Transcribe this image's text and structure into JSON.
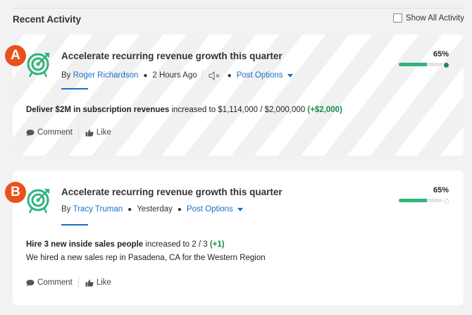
{
  "header": {
    "title": "Recent Activity",
    "show_all_label": "Show All Activity"
  },
  "colors": {
    "accent_link": "#1a6fc9",
    "badge": "#e9511c",
    "progress_fill": "#2fb47c",
    "delta_text": "#1d8a4e",
    "goal_icon": "#2fb47c"
  },
  "cards": [
    {
      "badge": "A",
      "icon": "target-arrow-icon",
      "title": "Accelerate recurring revenue growth this quarter",
      "by_label": "By",
      "author": "Roger Richardson",
      "time": "2 Hours Ago",
      "muted_icon": "speaker-muted-icon",
      "post_options_label": "Post Options",
      "progress_percent_label": "65%",
      "progress_value": 65,
      "update_metric": "Deliver $2M in subscription revenues",
      "update_text": "increased to $1,114,000 / $2,000,000",
      "update_delta": "(+$2,000)",
      "comment_label": "Comment",
      "like_label": "Like"
    },
    {
      "badge": "B",
      "icon": "target-arrow-icon",
      "title": "Accelerate recurring revenue growth this quarter",
      "by_label": "By",
      "author": "Tracy Truman",
      "time": "Yesterday",
      "post_options_label": "Post Options",
      "progress_percent_label": "65%",
      "progress_value": 65,
      "update_metric": "Hire 3 new inside sales people",
      "update_text": "increased to 2 / 3",
      "update_delta": "(+1)",
      "note": "We hired a new sales rep in Pasadena, CA for the Western Region",
      "comment_label": "Comment",
      "like_label": "Like"
    }
  ]
}
